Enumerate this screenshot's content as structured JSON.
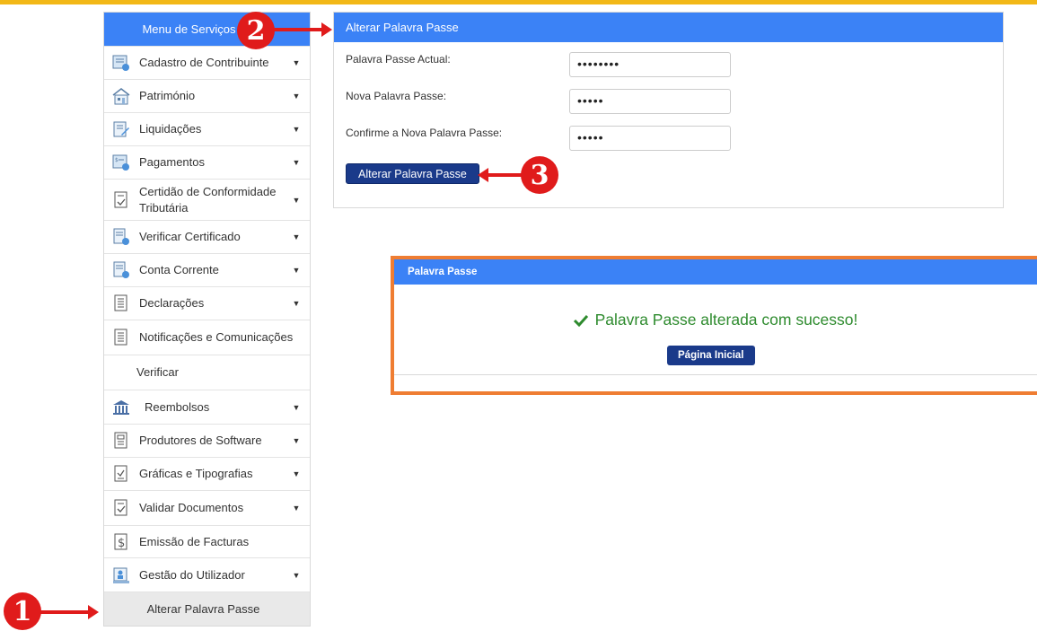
{
  "sidebar": {
    "title": "Menu de Serviços",
    "items": [
      {
        "label": "Cadastro de Contribuinte",
        "icon": "form-icon"
      },
      {
        "label": "Património",
        "icon": "house-icon"
      },
      {
        "label": "Liquidações",
        "icon": "edit-document-icon"
      },
      {
        "label": "Pagamentos",
        "icon": "payment-icon"
      },
      {
        "label": "Certidão de Conformidade Tributária",
        "icon": "certificate-icon"
      },
      {
        "label": "Verificar Certificado",
        "icon": "verify-certificate-icon"
      },
      {
        "label": "Conta Corrente",
        "icon": "account-icon"
      },
      {
        "label": "Declarações",
        "icon": "document-icon"
      },
      {
        "label": "Notificações e Comunicações",
        "icon": "document-icon"
      },
      {
        "label": "Verificar"
      },
      {
        "label": "Reembolsos",
        "icon": "bank-icon"
      },
      {
        "label": "Produtores de Software",
        "icon": "software-document-icon"
      },
      {
        "label": "Gráficas e Tipografias",
        "icon": "print-document-icon"
      },
      {
        "label": "Validar Documentos",
        "icon": "check-document-icon"
      },
      {
        "label": "Emissão de Facturas",
        "icon": "dollar-document-icon"
      },
      {
        "label": "Gestão do Utilizador",
        "icon": "user-management-icon"
      },
      {
        "label": "Alterar Palavra Passe"
      }
    ]
  },
  "form": {
    "title": "Alterar Palavra Passe",
    "current_label": "Palavra Passe Actual:",
    "current_value": "••••••••",
    "new_label": "Nova Palavra Passe:",
    "new_value": "•••••",
    "confirm_label": "Confirme a Nova Palavra Passe:",
    "confirm_value": "•••••",
    "submit_label": "Alterar Palavra Passe"
  },
  "dialog": {
    "title": "Palavra Passe",
    "message": "Palavra Passe alterada com sucesso!",
    "home_label": "Página Inicial"
  },
  "callouts": {
    "one": "1",
    "two": "2",
    "three": "3"
  },
  "colors": {
    "header_blue": "#3b82f6",
    "button_navy": "#1a3a8a",
    "success_green": "#2e8b2e",
    "dialog_border": "#ef7d32",
    "callout_red": "#e01b1b",
    "top_stripe": "#f2b817"
  }
}
